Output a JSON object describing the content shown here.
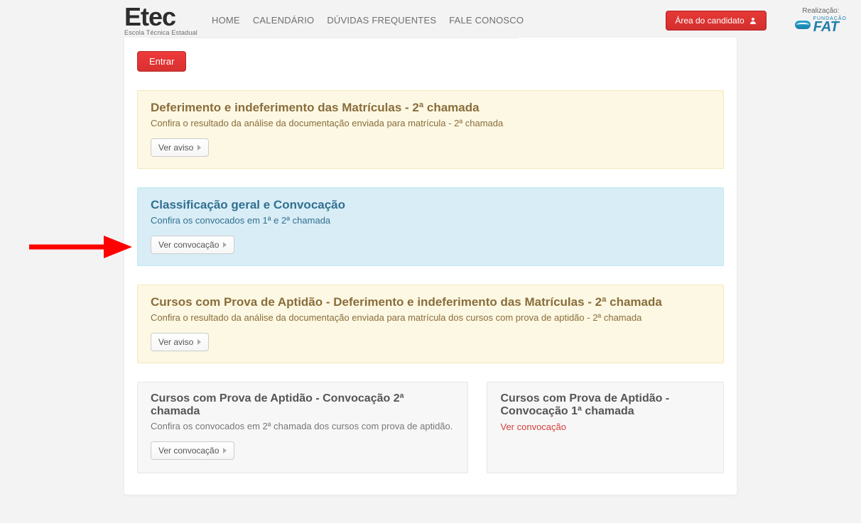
{
  "logo": {
    "text": "Etec",
    "sub": "Escola Técnica Estadual"
  },
  "nav": {
    "home": "HOME",
    "calendario": "CALENDÁRIO",
    "duvidas": "DÚVIDAS FREQUENTES",
    "fale": "FALE CONOSCO"
  },
  "header": {
    "area_candidato": "Área do candidato",
    "realizacao_label": "Realização:",
    "fat_fund": "FUNDAÇÃO",
    "fat_text": "FAT"
  },
  "entrar_label": "Entrar",
  "alerts": [
    {
      "kind": "yellow",
      "title": "Deferimento e indeferimento das Matrículas - 2ª chamada",
      "body": "Confira o resultado da análise da documentação enviada para matrícula - 2ª chamada",
      "button": "Ver aviso"
    },
    {
      "kind": "blue",
      "title": "Classificação geral e Convocação",
      "body": "Confira os convocados em 1ª e 2ª chamada",
      "button": "Ver convocação"
    },
    {
      "kind": "yellow",
      "title": "Cursos com Prova de Aptidão - Deferimento e indeferimento das Matrículas - 2ª chamada",
      "body": "Confira o resultado da análise da documentação enviada para matrícula dos cursos com prova de aptidão - 2ª chamada",
      "button": "Ver aviso"
    }
  ],
  "cards": [
    {
      "title": "Cursos com Prova de Aptidão - Convocação 2ª chamada",
      "body": "Confira os convocados em 2ª chamada dos cursos com prova de aptidão.",
      "button": "Ver convocação"
    },
    {
      "title": "Cursos com Prova de Aptidão - Convocação 1ª chamada",
      "link": "Ver convocação"
    }
  ]
}
